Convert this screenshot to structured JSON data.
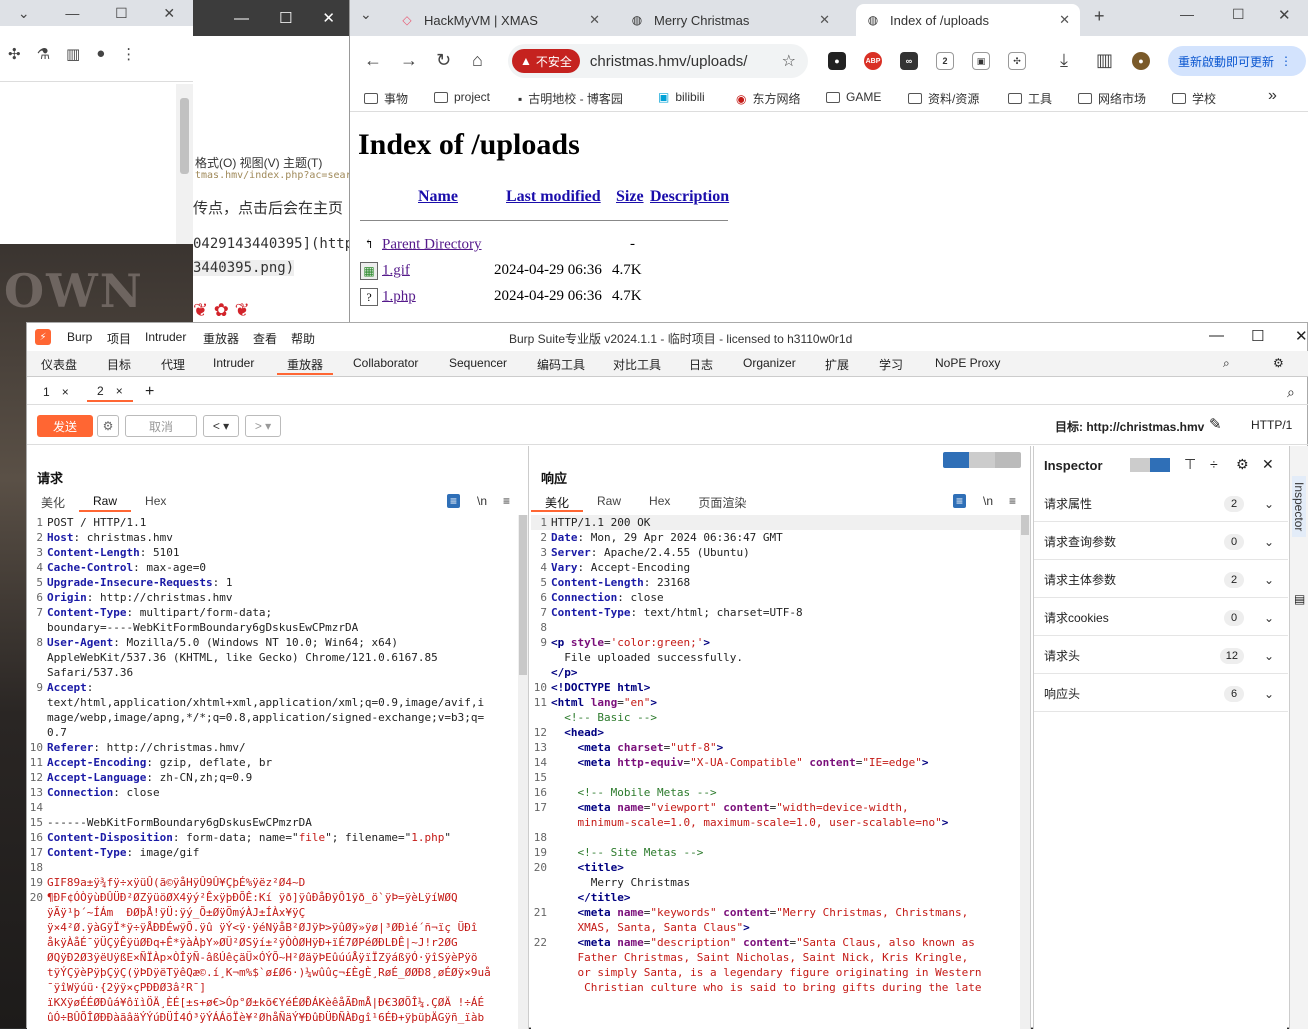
{
  "left_window": {
    "menu_label": "≡"
  },
  "editor_window": {
    "menu": "格式(O)  视图(V)  主题(T)",
    "url": "tmas.hmv/index.php?ac=search",
    "line1": "传点，点击后会在主页",
    "line2": "0429143440395](http",
    "line3": "3440395.png)"
  },
  "browser": {
    "tabs": [
      {
        "label": "HackMyVM | XMAS",
        "icon": "diamond-icon"
      },
      {
        "label": "Merry Christmas",
        "icon": "globe-icon"
      },
      {
        "label": "Index of /uploads",
        "icon": "globe-icon"
      }
    ],
    "insecure_label": "不安全",
    "url": "christmas.hmv/uploads/",
    "update_button": "重新啟動即可更新",
    "bookmarks": [
      "事物",
      "project",
      "古明地校 - 博客园",
      "bilibili",
      "东方网络",
      "GAME",
      "资料/资源",
      "工具",
      "网络市场",
      "学校"
    ],
    "page": {
      "heading": "Index of /uploads",
      "columns": [
        "Name",
        "Last modified",
        "Size",
        "Description"
      ],
      "rows": [
        {
          "name": "Parent Directory",
          "modified": "",
          "size": "-"
        },
        {
          "name": "1.gif",
          "modified": "2024-04-29 06:36",
          "size": "4.7K"
        },
        {
          "name": "1.php",
          "modified": "2024-04-29 06:36",
          "size": "4.7K"
        }
      ]
    }
  },
  "burp": {
    "menu": [
      "Burp",
      "项目",
      "Intruder",
      "重放器",
      "查看",
      "帮助"
    ],
    "window_title": "Burp Suite专业版  v2024.1.1 - 临时项目 - licensed to h3110w0r1d",
    "tabs": [
      "仪表盘",
      "目标",
      "代理",
      "Intruder",
      "重放器",
      "Collaborator",
      "Sequencer",
      "编码工具",
      "对比工具",
      "日志",
      "Organizer",
      "扩展",
      "学习",
      "NoPE Proxy"
    ],
    "subtabs": [
      "1",
      "2"
    ],
    "send_label": "发送",
    "cancel_label": "取消",
    "target_label": "目标: http://christmas.hmv",
    "http_label": "HTTP/1",
    "request": {
      "title": "请求",
      "tabs": [
        "美化",
        "Raw",
        "Hex"
      ]
    },
    "response": {
      "title": "响应",
      "tabs": [
        "美化",
        "Raw",
        "Hex",
        "页面渲染"
      ]
    },
    "inspector": {
      "title": "Inspector",
      "rows": [
        {
          "label": "请求属性",
          "count": "2"
        },
        {
          "label": "请求查询参数",
          "count": "0"
        },
        {
          "label": "请求主体参数",
          "count": "2"
        },
        {
          "label": "请求cookies",
          "count": "0"
        },
        {
          "label": "请求头",
          "count": "12"
        },
        {
          "label": "响应头",
          "count": "6"
        }
      ]
    },
    "side_label": "Inspector"
  }
}
